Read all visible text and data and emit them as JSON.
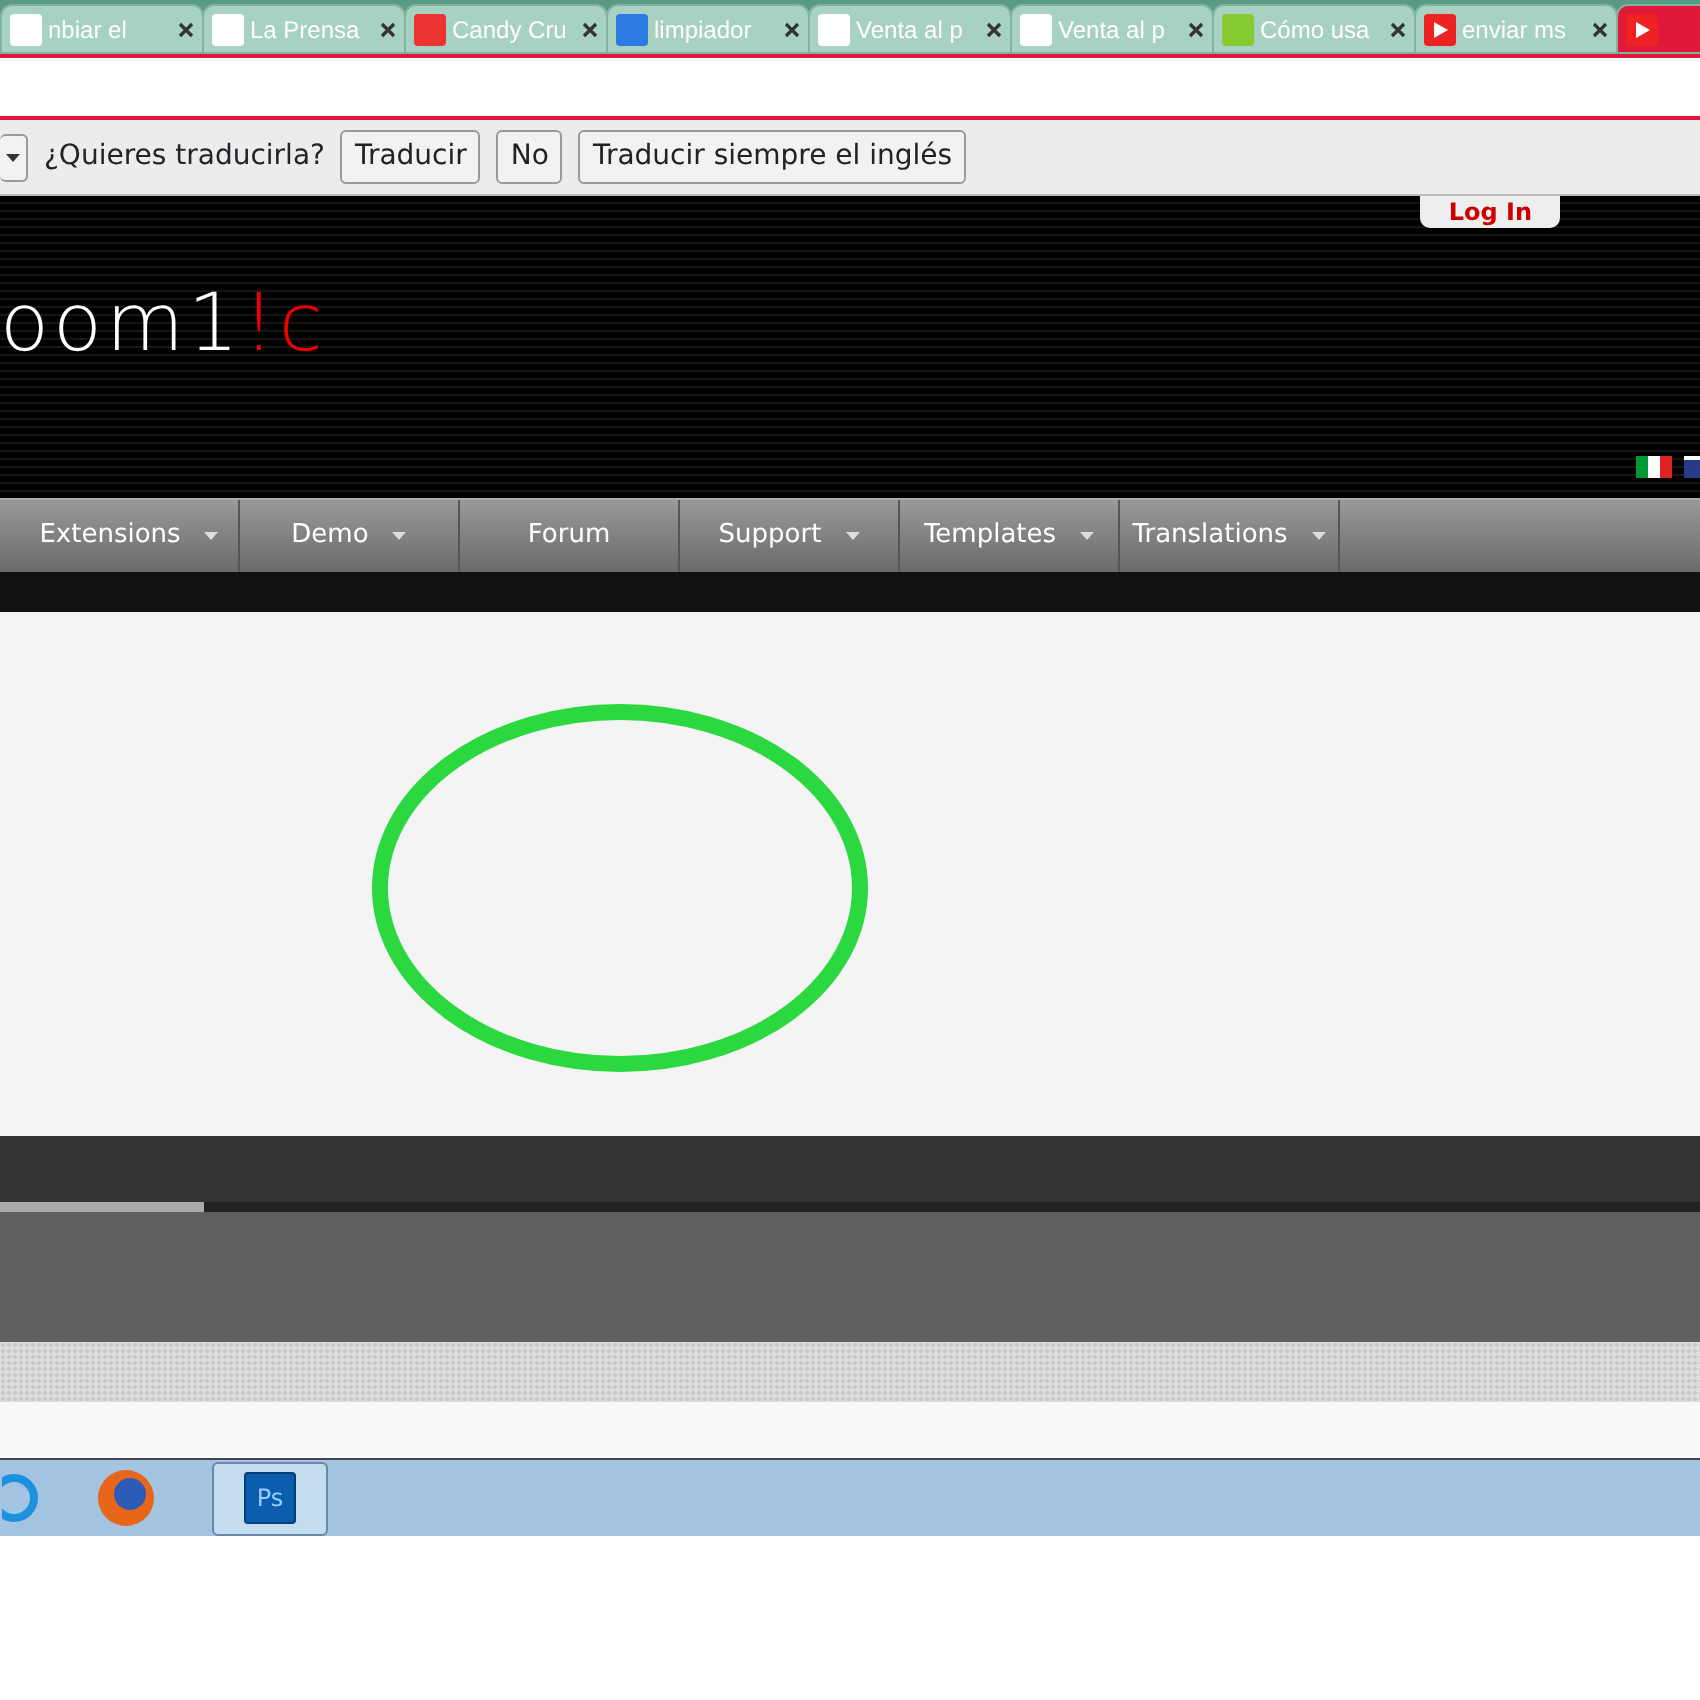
{
  "browser_tabs": [
    {
      "title": "nbiar el",
      "selected": false
    },
    {
      "title": "La Prensa",
      "selected": false
    },
    {
      "title": "Candy Cru",
      "selected": false
    },
    {
      "title": "limpiador",
      "selected": false
    },
    {
      "title": "Venta al p",
      "selected": false
    },
    {
      "title": "Venta al p",
      "selected": false
    },
    {
      "title": "Cómo usa",
      "selected": false
    },
    {
      "title": "enviar ms",
      "selected": false
    },
    {
      "selected": true
    }
  ],
  "translate_bar": {
    "prompt": "¿Quieres traducirla?",
    "buttons": [
      "Traducir",
      "No",
      "Traducir siempre el inglés"
    ]
  },
  "header": {
    "logo": [
      "oom1",
      "!c"
    ],
    "login": "Log In"
  },
  "nav": [
    {
      "label": "Extensions",
      "dropdown": true
    },
    {
      "label": "Demo",
      "dropdown": true
    },
    {
      "label": "Forum",
      "dropdown": false
    },
    {
      "label": "Support",
      "dropdown": true
    },
    {
      "label": "Templates",
      "dropdown": true
    },
    {
      "label": "Translations",
      "dropdown": true
    }
  ],
  "slider": {
    "level": 0.12
  },
  "taskbar": [
    {
      "selected": false
    },
    {
      "selected": false
    },
    {
      "label": "Ps",
      "selected": true
    }
  ]
}
